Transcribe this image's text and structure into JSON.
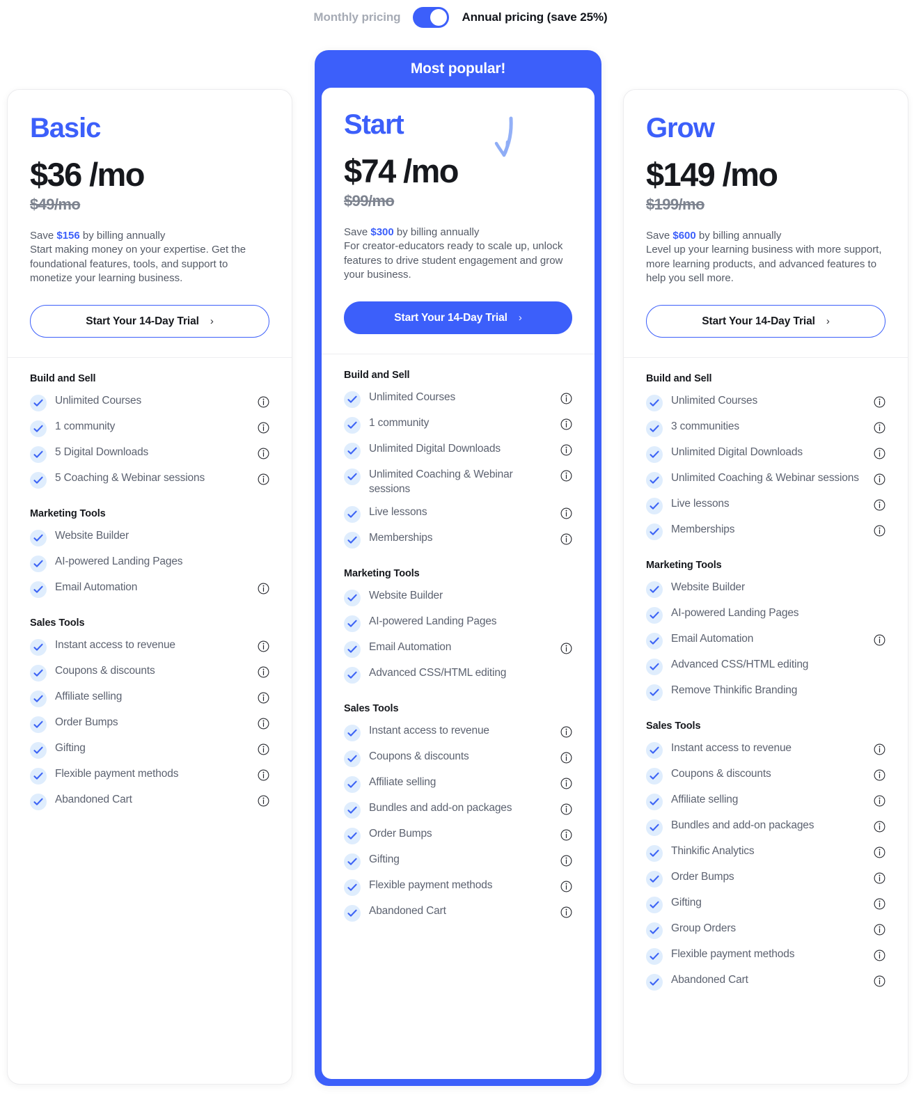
{
  "billing": {
    "monthly_label": "Monthly pricing",
    "annual_label": "Annual pricing (save 25%)",
    "toggle_state": "annual",
    "accent_color": "#3c5ffa"
  },
  "featured_banner": "Most popular!",
  "plans": [
    {
      "name": "Basic",
      "price": "$36",
      "period": "/mo",
      "old_price": "$49/mo",
      "save_prefix": "Save ",
      "save_amount": "$156",
      "save_suffix": " by billing annually",
      "description": "Start making money on your expertise. Get the foundational features, tools, and support to monetize your learning business.",
      "cta_label": "Start Your 14-Day Trial",
      "cta_chevron": "›",
      "groups": [
        {
          "title": "Build and Sell",
          "items": [
            {
              "label": "Unlimited Courses",
              "info": true
            },
            {
              "label": "1 community",
              "info": true
            },
            {
              "label": "5 Digital Downloads",
              "info": true
            },
            {
              "label": "5 Coaching & Webinar sessions",
              "info": true
            }
          ]
        },
        {
          "title": "Marketing Tools",
          "items": [
            {
              "label": "Website Builder",
              "info": false
            },
            {
              "label": "AI-powered Landing Pages",
              "info": false
            },
            {
              "label": "Email Automation",
              "info": true
            }
          ]
        },
        {
          "title": "Sales Tools",
          "items": [
            {
              "label": "Instant access to revenue",
              "info": true
            },
            {
              "label": "Coupons & discounts",
              "info": true
            },
            {
              "label": "Affiliate selling",
              "info": true
            },
            {
              "label": "Order Bumps",
              "info": true
            },
            {
              "label": "Gifting",
              "info": true
            },
            {
              "label": "Flexible payment methods",
              "info": true
            },
            {
              "label": "Abandoned Cart",
              "info": true
            }
          ]
        }
      ]
    },
    {
      "name": "Start",
      "price": "$74",
      "period": "/mo",
      "old_price": "$99/mo",
      "save_prefix": "Save ",
      "save_amount": "$300",
      "save_suffix": " by billing annually",
      "description": "For creator-educators ready to scale up, unlock features to drive student engagement and grow your business.",
      "cta_label": "Start Your 14-Day Trial",
      "cta_chevron": "›",
      "groups": [
        {
          "title": "Build and Sell",
          "items": [
            {
              "label": "Unlimited Courses",
              "info": true
            },
            {
              "label": "1 community",
              "info": true
            },
            {
              "label": "Unlimited Digital Downloads",
              "info": true
            },
            {
              "label": "Unlimited Coaching & Webinar sessions",
              "info": true
            },
            {
              "label": "Live lessons",
              "info": true
            },
            {
              "label": "Memberships",
              "info": true
            }
          ]
        },
        {
          "title": "Marketing Tools",
          "items": [
            {
              "label": "Website Builder",
              "info": false
            },
            {
              "label": "AI-powered Landing Pages",
              "info": false
            },
            {
              "label": "Email Automation",
              "info": true
            },
            {
              "label": "Advanced CSS/HTML editing",
              "info": false
            }
          ]
        },
        {
          "title": "Sales Tools",
          "items": [
            {
              "label": "Instant access to revenue",
              "info": true
            },
            {
              "label": "Coupons & discounts",
              "info": true
            },
            {
              "label": "Affiliate selling",
              "info": true
            },
            {
              "label": "Bundles and add-on packages",
              "info": true
            },
            {
              "label": "Order Bumps",
              "info": true
            },
            {
              "label": "Gifting",
              "info": true
            },
            {
              "label": "Flexible payment methods",
              "info": true
            },
            {
              "label": "Abandoned Cart",
              "info": true
            }
          ]
        }
      ]
    },
    {
      "name": "Grow",
      "price": "$149",
      "period": "/mo",
      "old_price": "$199/mo",
      "save_prefix": "Save ",
      "save_amount": "$600",
      "save_suffix": " by billing annually",
      "description": "Level up your learning business with more support, more learning products, and advanced features to help you sell more.",
      "cta_label": "Start Your 14-Day Trial",
      "cta_chevron": "›",
      "groups": [
        {
          "title": "Build and Sell",
          "items": [
            {
              "label": "Unlimited Courses",
              "info": true
            },
            {
              "label": "3 communities",
              "info": true
            },
            {
              "label": "Unlimited Digital Downloads",
              "info": true
            },
            {
              "label": "Unlimited Coaching & Webinar sessions",
              "info": true
            },
            {
              "label": "Live lessons",
              "info": true
            },
            {
              "label": "Memberships",
              "info": true
            }
          ]
        },
        {
          "title": "Marketing Tools",
          "items": [
            {
              "label": "Website Builder",
              "info": false
            },
            {
              "label": "AI-powered Landing Pages",
              "info": false
            },
            {
              "label": "Email Automation",
              "info": true
            },
            {
              "label": "Advanced CSS/HTML editing",
              "info": false
            },
            {
              "label": "Remove Thinkific Branding",
              "info": false
            }
          ]
        },
        {
          "title": "Sales Tools",
          "items": [
            {
              "label": "Instant access to revenue",
              "info": true
            },
            {
              "label": "Coupons & discounts",
              "info": true
            },
            {
              "label": "Affiliate selling",
              "info": true
            },
            {
              "label": "Bundles and add-on packages",
              "info": true
            },
            {
              "label": "Thinkific Analytics",
              "info": true
            },
            {
              "label": "Order Bumps",
              "info": true
            },
            {
              "label": "Gifting",
              "info": true
            },
            {
              "label": "Group Orders",
              "info": true
            },
            {
              "label": "Flexible payment methods",
              "info": true
            },
            {
              "label": "Abandoned Cart",
              "info": true
            }
          ]
        }
      ]
    }
  ]
}
